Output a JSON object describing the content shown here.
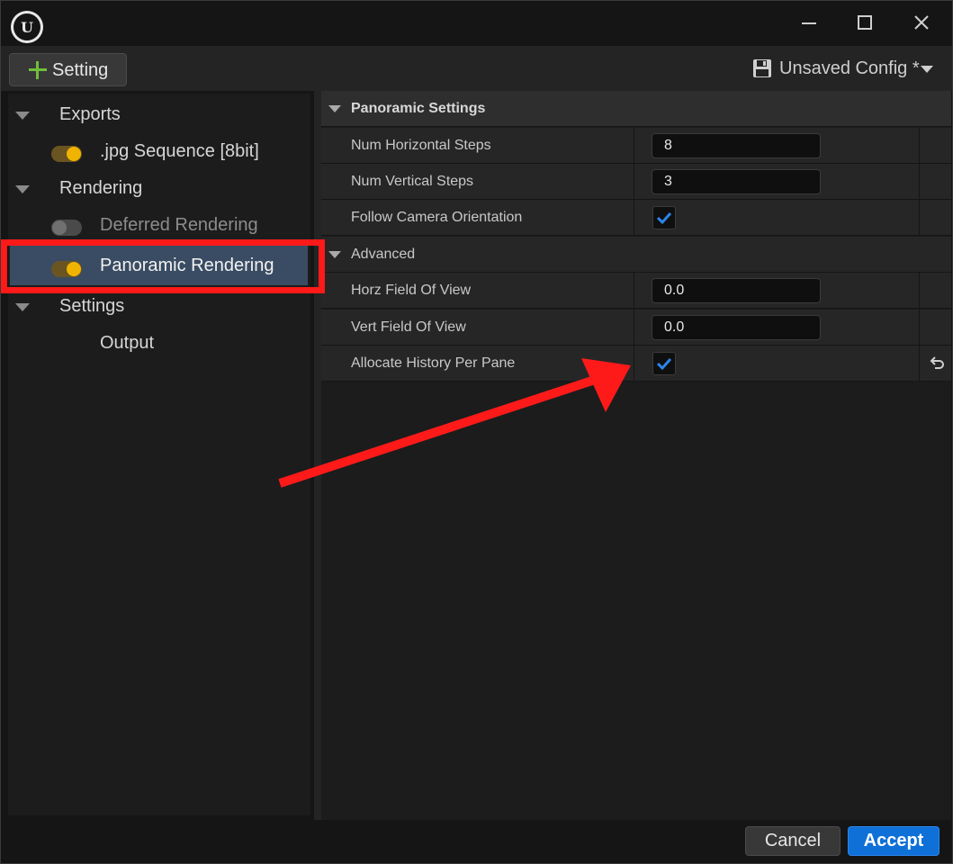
{
  "window": {
    "logo_letter": "U"
  },
  "toolbar": {
    "add_setting_label": "Setting",
    "config_label": "Unsaved Config *"
  },
  "tree": {
    "exports_label": "Exports",
    "jpg_label": ".jpg Sequence [8bit]",
    "rendering_label": "Rendering",
    "deferred_label": "Deferred Rendering",
    "panoramic_label": "Panoramic Rendering",
    "settings_label": "Settings",
    "output_label": "Output"
  },
  "details": {
    "section_title": "Panoramic Settings",
    "advanced_title": "Advanced",
    "rows": [
      {
        "name": "Num Horizontal Steps",
        "value": "8"
      },
      {
        "name": "Num Vertical Steps",
        "value": "3"
      },
      {
        "name": "Follow Camera Orientation",
        "checked": true
      },
      {
        "name": "Horz Field Of View",
        "value": "0.0"
      },
      {
        "name": "Vert Field Of View",
        "value": "0.0"
      },
      {
        "name": "Allocate History Per Pane",
        "checked": true
      }
    ]
  },
  "footer": {
    "cancel_label": "Cancel",
    "accept_label": "Accept"
  },
  "colors": {
    "accent_blue": "#0f70d8",
    "toggle_on": "#f0b400",
    "selection": "#3a4c63",
    "annotation_red": "#ff1a1a"
  }
}
